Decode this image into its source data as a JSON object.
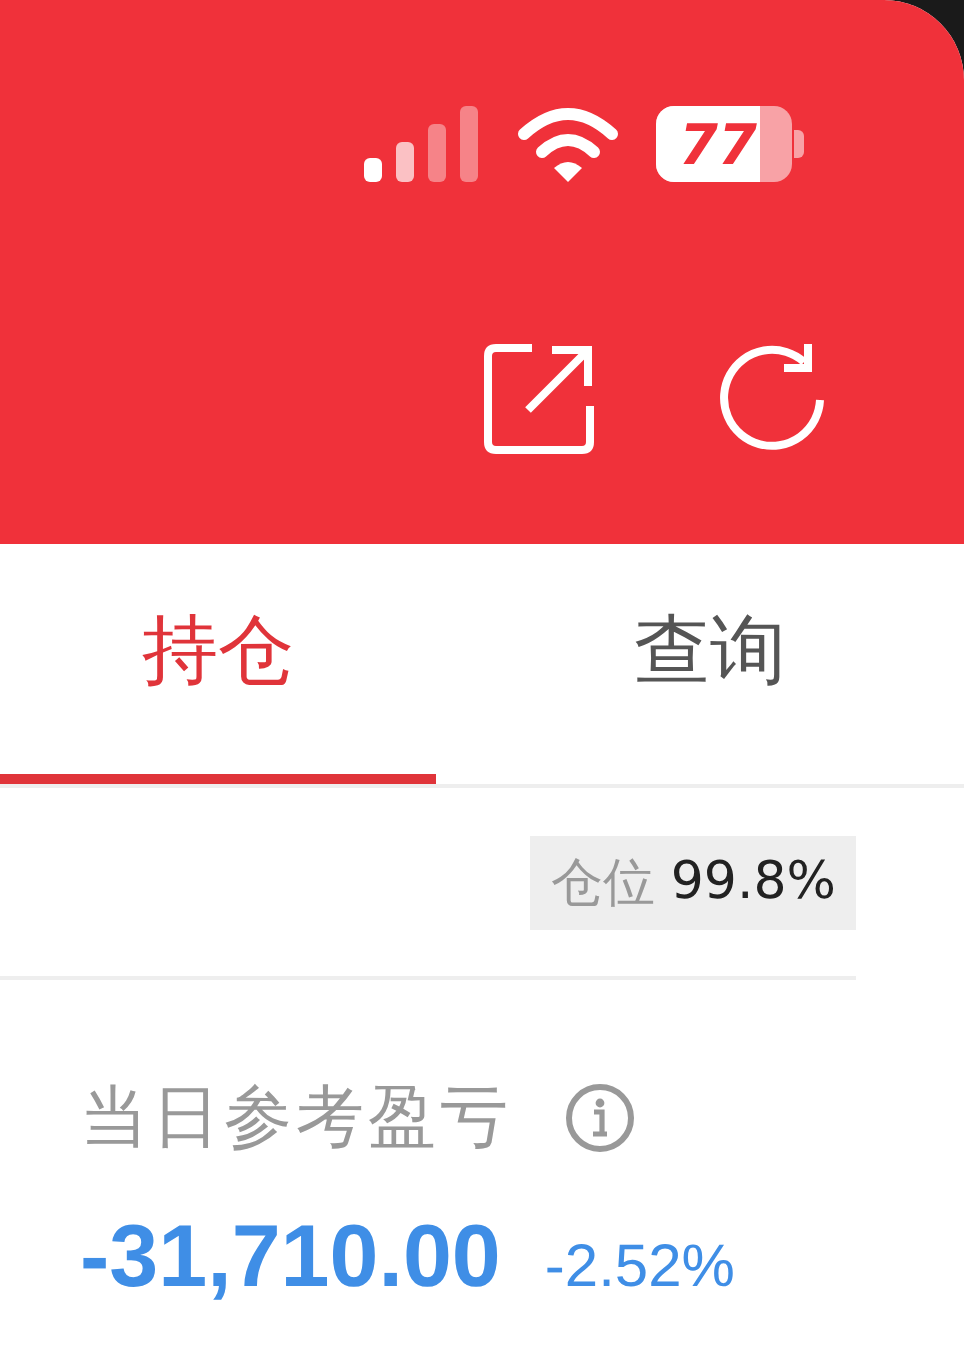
{
  "status_bar": {
    "battery": "77"
  },
  "tabs": [
    {
      "label": "持仓",
      "selected": true
    },
    {
      "label": "查询",
      "selected": false
    }
  ],
  "position": {
    "label": "仓位",
    "value": "99.8%"
  },
  "daily_pnl": {
    "label": "当日参考盈亏",
    "amount": "-31,710.00",
    "percent": "-2.52%"
  }
}
